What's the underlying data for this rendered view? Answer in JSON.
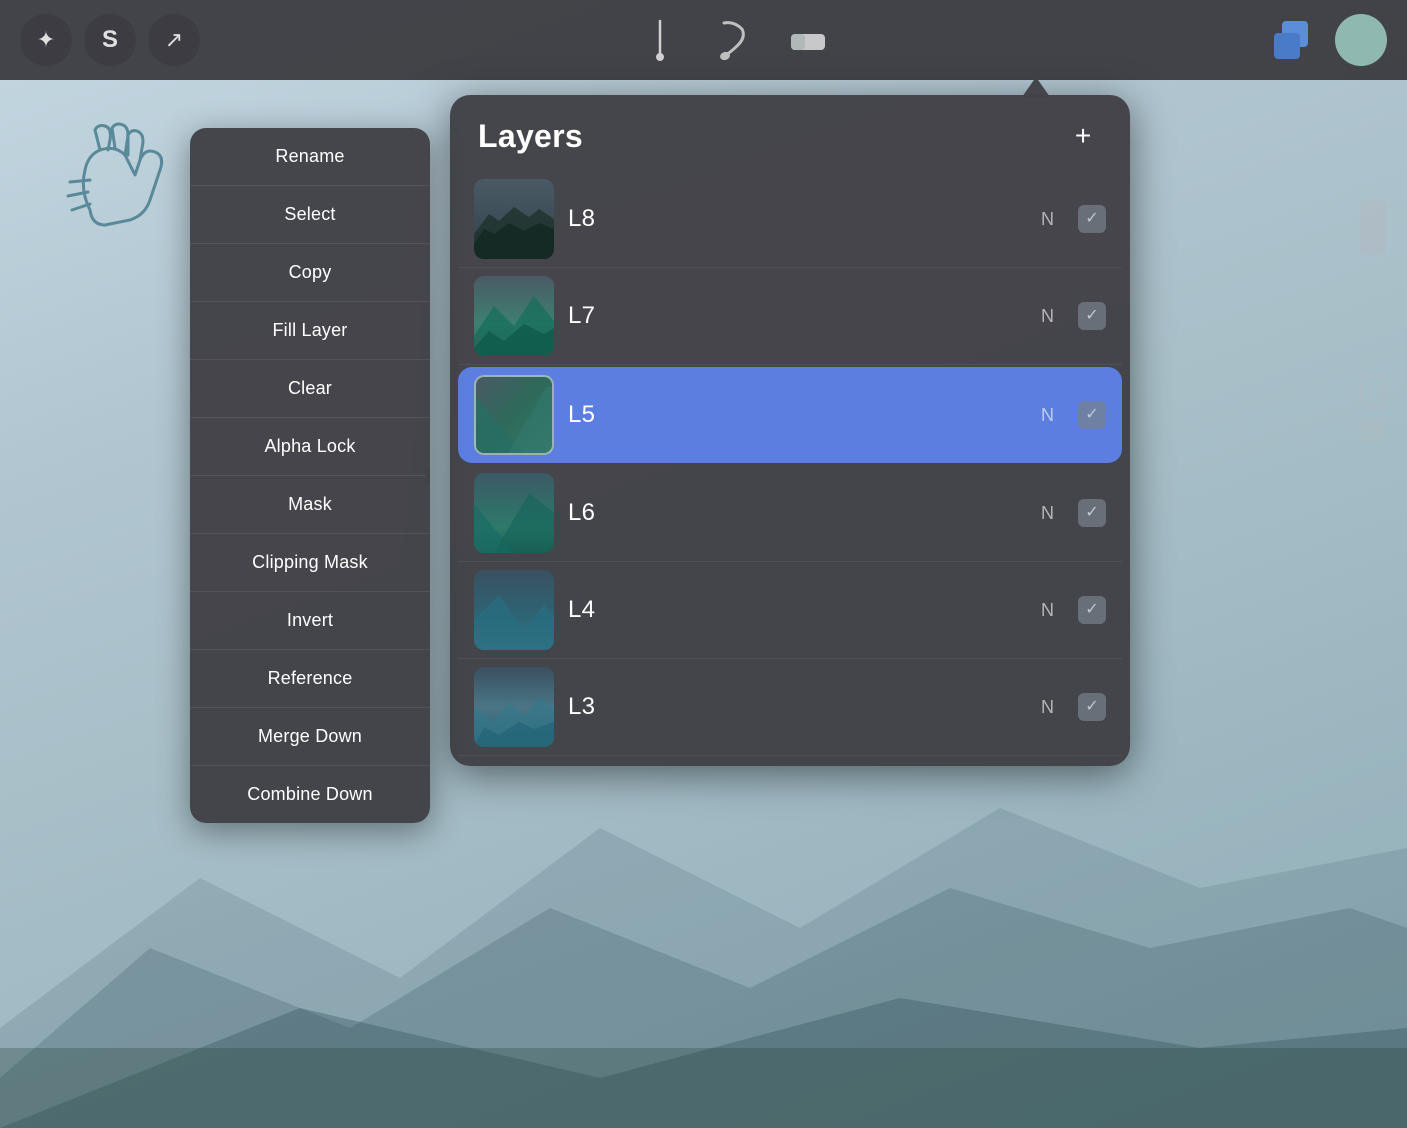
{
  "toolbar": {
    "tools": [
      {
        "name": "magic-wand",
        "symbol": "✦",
        "active": true
      },
      {
        "name": "stylize",
        "symbol": "S",
        "active": false
      },
      {
        "name": "transform",
        "symbol": "↗",
        "active": false
      }
    ],
    "center_tools": [
      {
        "name": "brush",
        "symbol": "brush"
      },
      {
        "name": "smudge",
        "symbol": "smudge"
      },
      {
        "name": "eraser",
        "symbol": "eraser"
      }
    ],
    "layers_label": "layers",
    "add_label": "+"
  },
  "context_menu": {
    "items": [
      {
        "label": "Rename",
        "name": "rename"
      },
      {
        "label": "Select",
        "name": "select"
      },
      {
        "label": "Copy",
        "name": "copy"
      },
      {
        "label": "Fill Layer",
        "name": "fill-layer"
      },
      {
        "label": "Clear",
        "name": "clear"
      },
      {
        "label": "Alpha Lock",
        "name": "alpha-lock"
      },
      {
        "label": "Mask",
        "name": "mask"
      },
      {
        "label": "Clipping Mask",
        "name": "clipping-mask"
      },
      {
        "label": "Invert",
        "name": "invert"
      },
      {
        "label": "Reference",
        "name": "reference"
      },
      {
        "label": "Merge Down",
        "name": "merge-down"
      },
      {
        "label": "Combine Down",
        "name": "combine-down"
      }
    ]
  },
  "layers_panel": {
    "title": "Layers",
    "add_button": "+",
    "layers": [
      {
        "id": "L8",
        "name": "L8",
        "mode": "N",
        "visible": true,
        "active": false,
        "thumb": "l8"
      },
      {
        "id": "L7",
        "name": "L7",
        "mode": "N",
        "visible": true,
        "active": false,
        "thumb": "l7"
      },
      {
        "id": "L5",
        "name": "L5",
        "mode": "N",
        "visible": true,
        "active": true,
        "thumb": "l5"
      },
      {
        "id": "L6",
        "name": "L6",
        "mode": "N",
        "visible": true,
        "active": false,
        "thumb": "l6"
      },
      {
        "id": "L4",
        "name": "L4",
        "mode": "N",
        "visible": true,
        "active": false,
        "thumb": "l4"
      },
      {
        "id": "L3",
        "name": "L3",
        "mode": "N",
        "visible": true,
        "active": false,
        "thumb": "l3"
      }
    ]
  }
}
